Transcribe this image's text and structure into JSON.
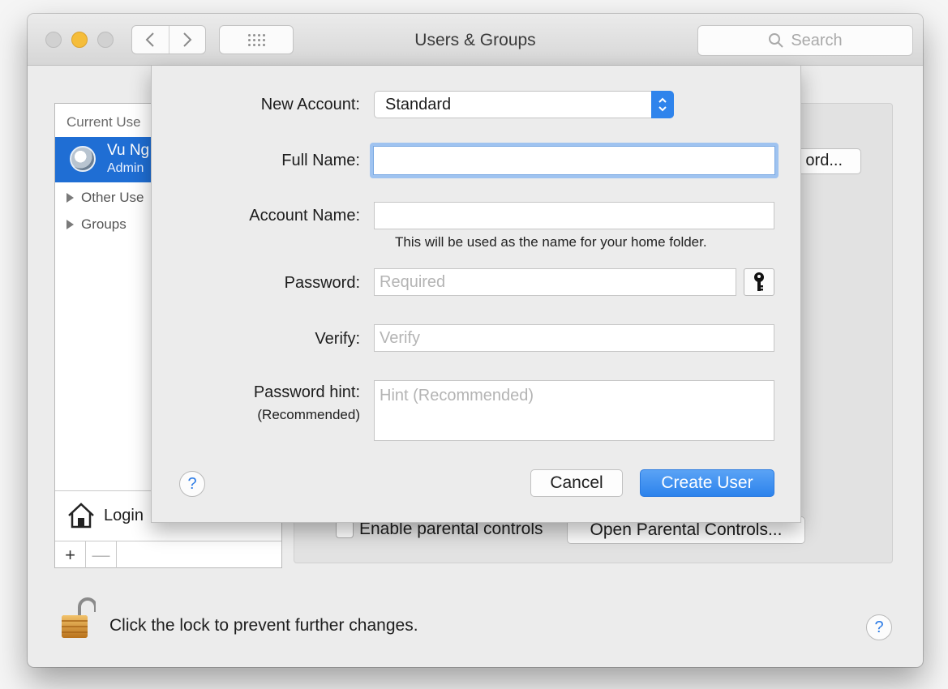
{
  "window": {
    "title": "Users & Groups",
    "search_placeholder": "Search"
  },
  "sidebar": {
    "heading": "Current Use",
    "current_user": {
      "name": "Vu Ng",
      "role": "Admin"
    },
    "other_users_label": "Other Use",
    "groups_label": "Groups",
    "login_label": "Login",
    "add_label": "+",
    "remove_label": "—"
  },
  "main": {
    "password_button_label": "ord...",
    "parental_controls_label": "Enable parental controls",
    "open_parental_label": "Open Parental Controls...",
    "lock_text": "Click the lock to prevent further changes.",
    "help_label": "?"
  },
  "sheet": {
    "new_account_label": "New Account:",
    "new_account_value": "Standard",
    "full_name_label": "Full Name:",
    "full_name_value": "",
    "account_name_label": "Account Name:",
    "account_name_value": "",
    "account_name_note": "This will be used as the name for your home folder.",
    "password_label": "Password:",
    "password_placeholder": "Required",
    "verify_label": "Verify:",
    "verify_placeholder": "Verify",
    "hint_label": "Password hint:",
    "hint_sublabel": "(Recommended)",
    "hint_placeholder": "Hint (Recommended)",
    "help_label": "?",
    "cancel_label": "Cancel",
    "create_label": "Create User"
  },
  "icons": {
    "back": "chevron-left-icon",
    "forward": "chevron-right-icon",
    "show_all": "grid-icon",
    "search": "search-icon",
    "popup": "up-down-arrows-icon",
    "key": "key-icon",
    "home": "house-icon",
    "lock": "padlock-icon"
  },
  "colors": {
    "accent": "#2f84ec",
    "selection": "#1f6ed4",
    "minimize": "#f5bd3a"
  }
}
